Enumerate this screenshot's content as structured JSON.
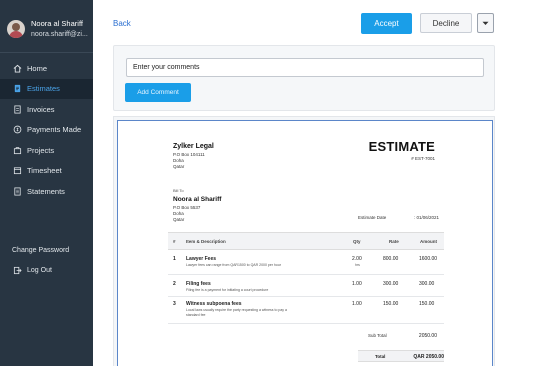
{
  "user": {
    "name": "Noora al Shariff",
    "email": "noora.shariff@zi..."
  },
  "sidebar": {
    "items": [
      {
        "label": "Home",
        "icon": "home-icon"
      },
      {
        "label": "Estimates",
        "icon": "estimate-icon",
        "active": true
      },
      {
        "label": "Invoices",
        "icon": "invoice-icon"
      },
      {
        "label": "Payments Made",
        "icon": "payment-icon"
      },
      {
        "label": "Projects",
        "icon": "projects-icon"
      },
      {
        "label": "Timesheet",
        "icon": "timesheet-icon"
      },
      {
        "label": "Statements",
        "icon": "statements-icon"
      }
    ],
    "change_password": "Change Password",
    "logout": "Log Out"
  },
  "header": {
    "back": "Back",
    "accept": "Accept",
    "decline": "Decline"
  },
  "comment": {
    "value": "Enter your comments",
    "add_label": "Add Comment"
  },
  "estimate": {
    "org_name": "Zylker Legal",
    "org_address": [
      "P.O Box 104111",
      "Doha",
      "Qatar"
    ],
    "title": "ESTIMATE",
    "number": "# EST-7001",
    "bill_to_label": "Bill To",
    "client_name": "Noora al Shariff",
    "client_address": [
      "P.O Box 5537",
      "Doha",
      "Qatar"
    ],
    "date_label": "Estimate Date",
    "date_value": ": 01/06/2021",
    "columns": [
      "#",
      "Item & Description",
      "Qty",
      "Rate",
      "Amount"
    ],
    "items": [
      {
        "num": "1",
        "name": "Lawyer Fees",
        "desc": "Lawyer fees can range from QAR1500 to QAR 2000 per hour",
        "qty": "2.00",
        "unit": "hrs",
        "rate": "800.00",
        "amount": "1600.00"
      },
      {
        "num": "2",
        "name": "Filing fees",
        "desc": "Filing fee is a payment for initiating a court procedure",
        "qty": "1.00",
        "unit": "",
        "rate": "300.00",
        "amount": "300.00"
      },
      {
        "num": "3",
        "name": "Witness subpoena fees",
        "desc": "Local laws usually require the party requesting a witness to pay a standard fee",
        "qty": "1.00",
        "unit": "",
        "rate": "150.00",
        "amount": "150.00"
      }
    ],
    "subtotal_label": "Sub Total",
    "subtotal_value": "2050.00",
    "total_label": "Total",
    "total_value": "QAR 2050.00"
  }
}
